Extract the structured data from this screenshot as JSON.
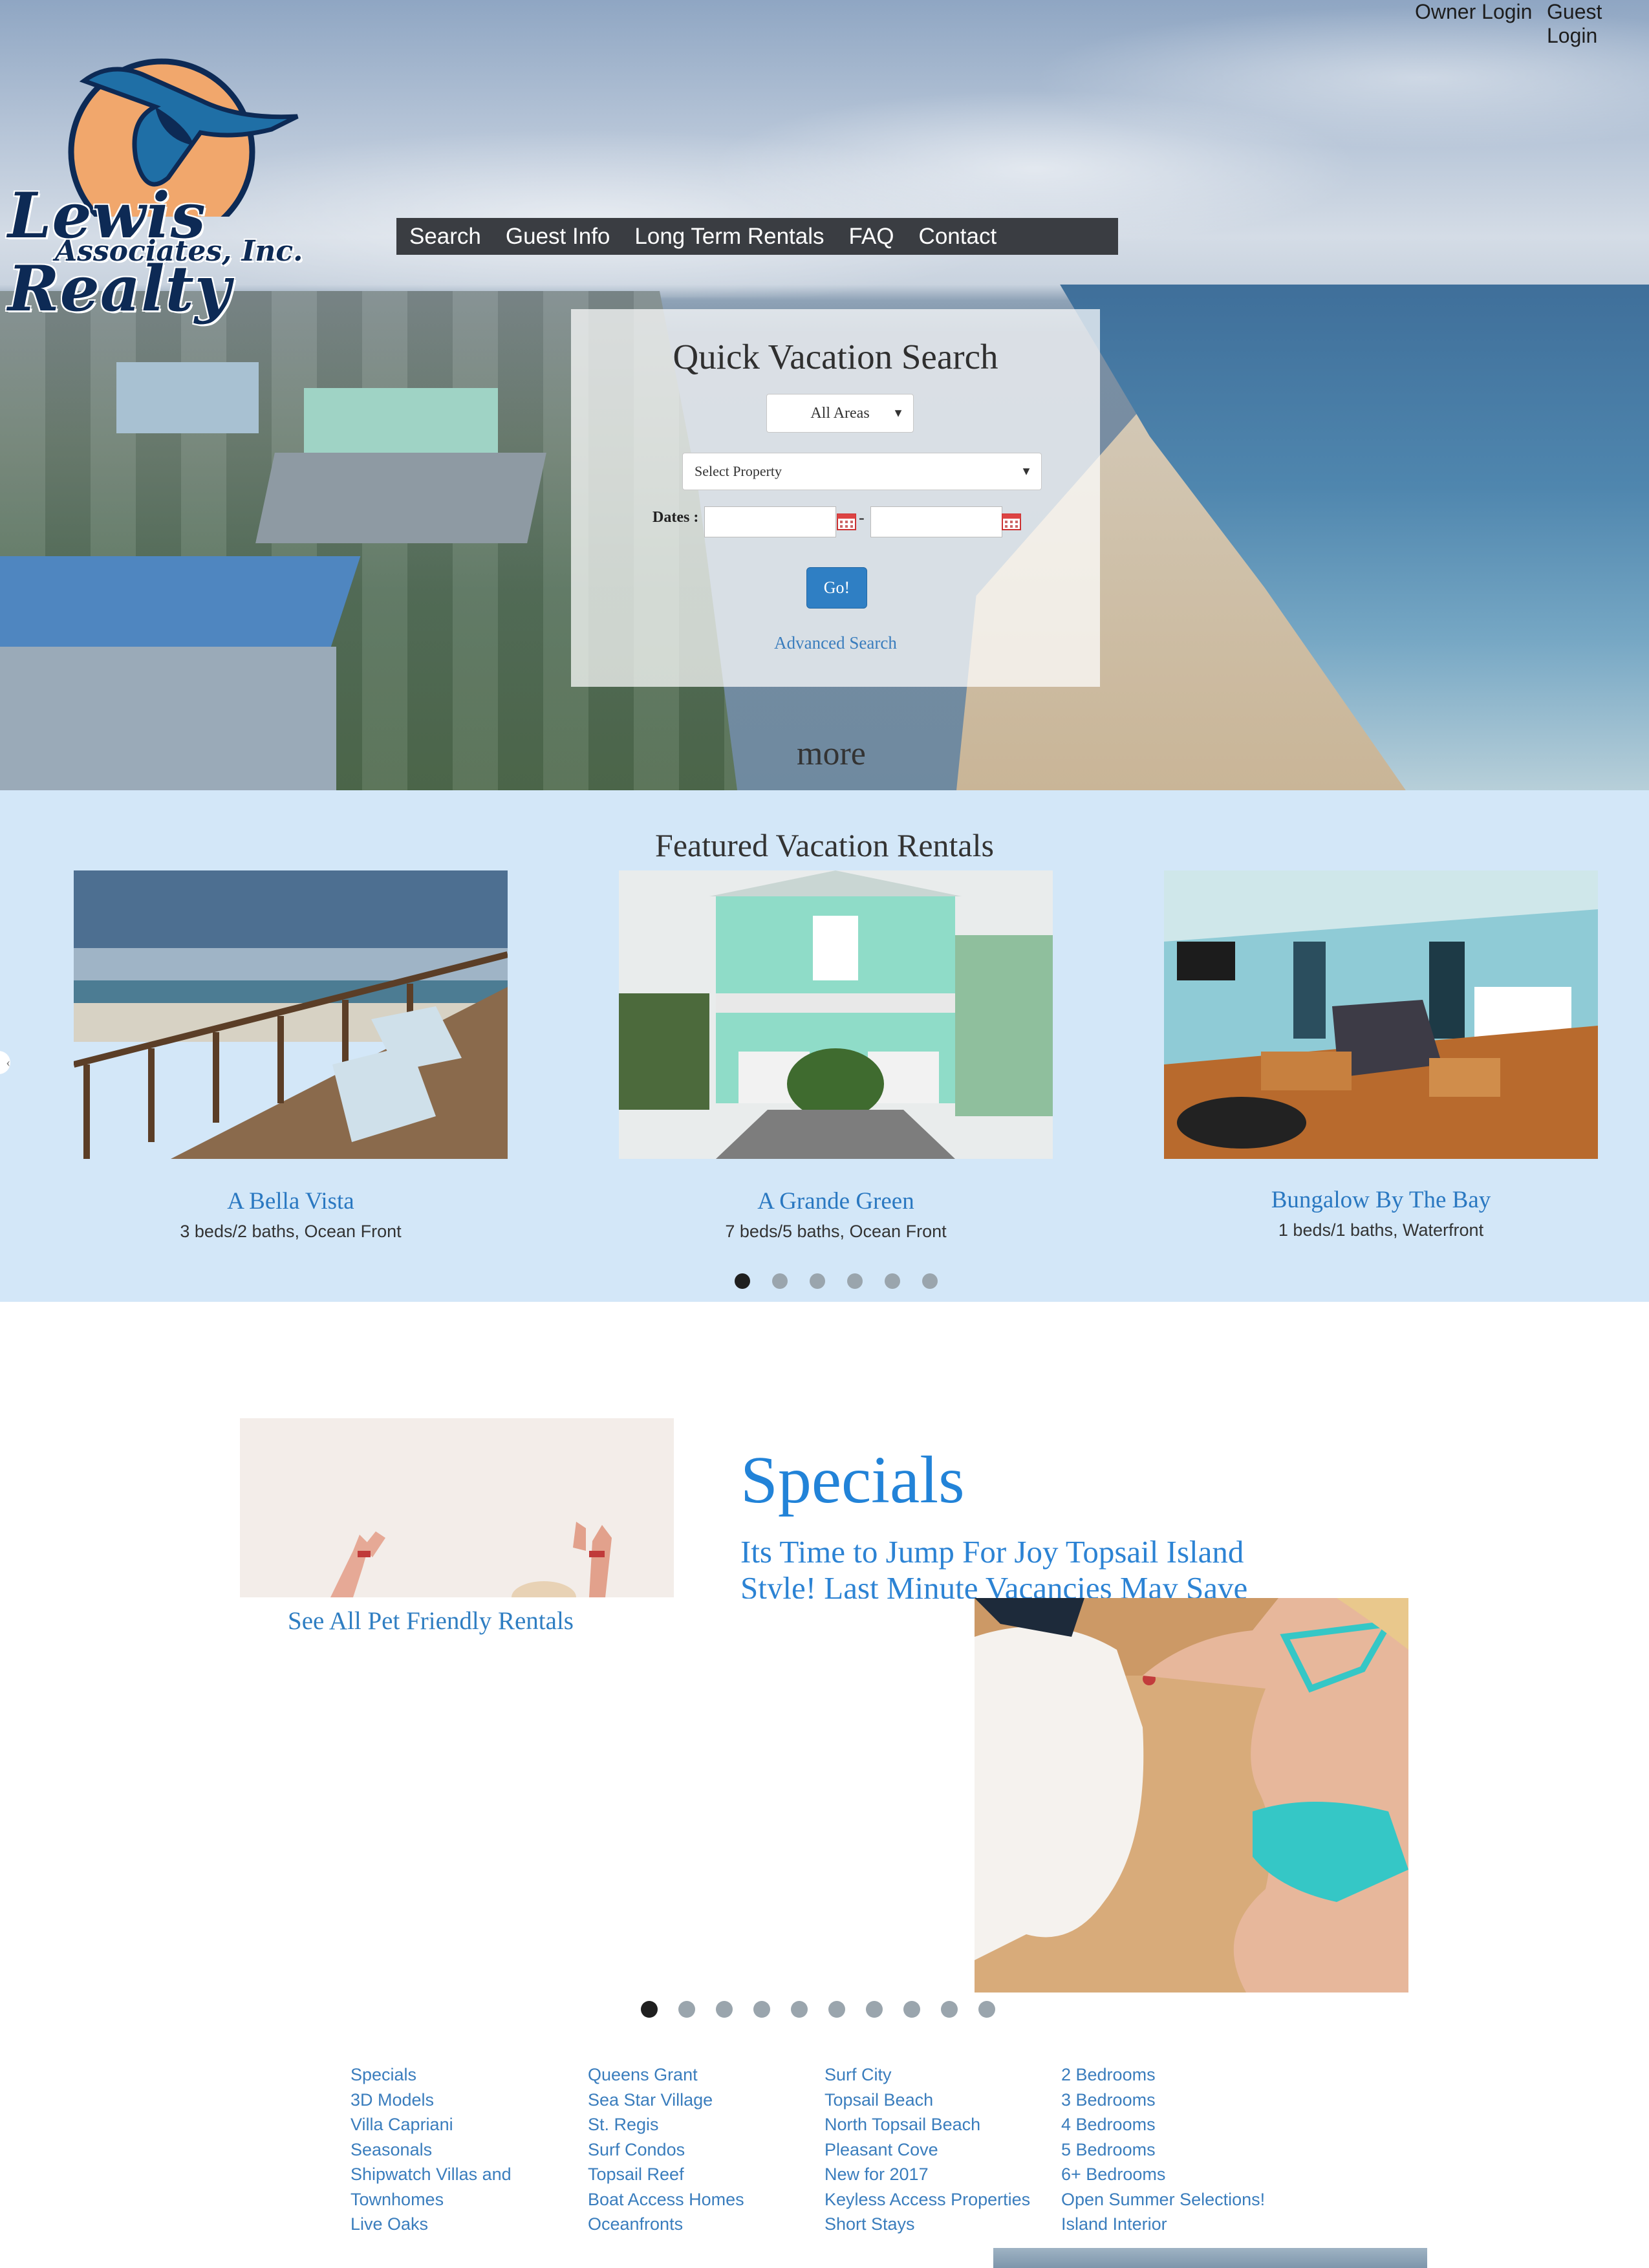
{
  "header": {
    "logo_text": "Lewis Realty",
    "logo_subtext": "Associates, Inc.",
    "owner_login": "Owner Login",
    "guest_login": "Guest Login"
  },
  "nav": {
    "items": [
      "Search",
      "Guest Info",
      "Long Term Rentals",
      "FAQ",
      "Contact"
    ]
  },
  "quick_search": {
    "title": "Quick Vacation Search",
    "areas_select": "All Areas",
    "property_select": "Select Property",
    "dates_label": "Dates :",
    "date_separator": "-",
    "go_button": "Go!",
    "advanced_link": "Advanced Search"
  },
  "hero": {
    "more_link": "more"
  },
  "featured": {
    "title": "Featured Vacation Rentals",
    "cards": [
      {
        "name": "A Bella Vista",
        "desc": "3 beds/2 baths, Ocean Front"
      },
      {
        "name": "A Grande Green",
        "desc": "7 beds/5 baths, Ocean Front"
      },
      {
        "name": "Bungalow By The Bay",
        "desc": "1 beds/1 baths, Waterfront"
      }
    ],
    "dots_count": 6,
    "active_dot": 0
  },
  "specials": {
    "pet_link": "See All Pet Friendly Rentals",
    "title": "Specials",
    "text": "Its Time to Jump For Joy Topsail Island Style! Last Minute Vacancies May Save",
    "dots_count": 10,
    "active_dot": 0
  },
  "footer": {
    "col1": [
      "Specials",
      "3D Models",
      "Villa Capriani",
      "Seasonals",
      "Shipwatch Villas and Townhomes",
      "Live Oaks"
    ],
    "col2": [
      "Queens Grant",
      "Sea Star Village",
      "St. Regis",
      "Surf Condos",
      "Topsail Reef",
      "Boat Access Homes",
      "Oceanfronts"
    ],
    "col3": [
      "Surf City",
      "Topsail Beach",
      "North Topsail Beach",
      "Pleasant Cove",
      "New for 2017",
      "Keyless Access Properties",
      "Short Stays"
    ],
    "col4": [
      "2 Bedrooms",
      "3 Bedrooms",
      "4 Bedrooms",
      "5 Bedrooms",
      "6+ Bedrooms",
      "Open Summer Selections!",
      "Island Interior"
    ]
  },
  "colors": {
    "accent_blue": "#2283d8",
    "link_blue": "#3a7dbd",
    "nav_bg": "#3a3d42",
    "featured_bg": "#d3e7f8",
    "button_blue": "#2f7fc4"
  },
  "icons": [
    "calendar-icon",
    "chevron-left-icon",
    "dropdown-arrow-icon"
  ]
}
